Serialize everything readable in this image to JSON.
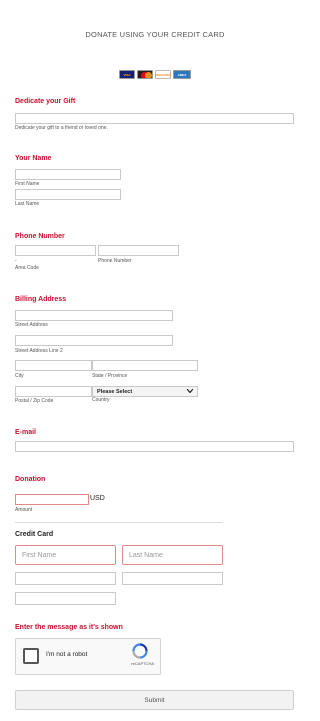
{
  "header": {
    "title": "DONATE USING YOUR CREDIT CARD"
  },
  "cards": {
    "visa": "VISA",
    "mastercard": "MasterCard",
    "discover": "DISCOVER",
    "amex": "AMERICAN EXPRESS"
  },
  "gift": {
    "heading": "Dedicate your Gift",
    "help": "Dedicate your gift to a friend or loved one."
  },
  "name": {
    "heading": "Your Name",
    "first_label": "First Name",
    "last_label": "Last Name"
  },
  "phone": {
    "heading": "Phone Number",
    "dash": "-",
    "area_label": "Area Code",
    "number_label": "Phone Number"
  },
  "billing": {
    "heading": "Billing Address",
    "street_label": "Street Address",
    "street2_label": "Street Address Line 2",
    "city_label": "City",
    "state_label": "State / Province",
    "zip_label": "Postal / Zip Code",
    "country_label": "Country",
    "country_selected": "Please Select"
  },
  "email": {
    "heading": "E-mail"
  },
  "donation": {
    "heading": "Donation",
    "currency": "USD",
    "amount_label": "Amount"
  },
  "credit_card": {
    "heading": "Credit Card",
    "first_placeholder": "First Name",
    "last_placeholder": "Last Name"
  },
  "captcha": {
    "heading": "Enter the message as it's shown",
    "checkbox_label": "I'm not a robot",
    "brand": "reCAPTCHA"
  },
  "submit": {
    "label": "Submit"
  },
  "colors": {
    "accent": "#c8102e",
    "error_border": "#e08a8a"
  }
}
